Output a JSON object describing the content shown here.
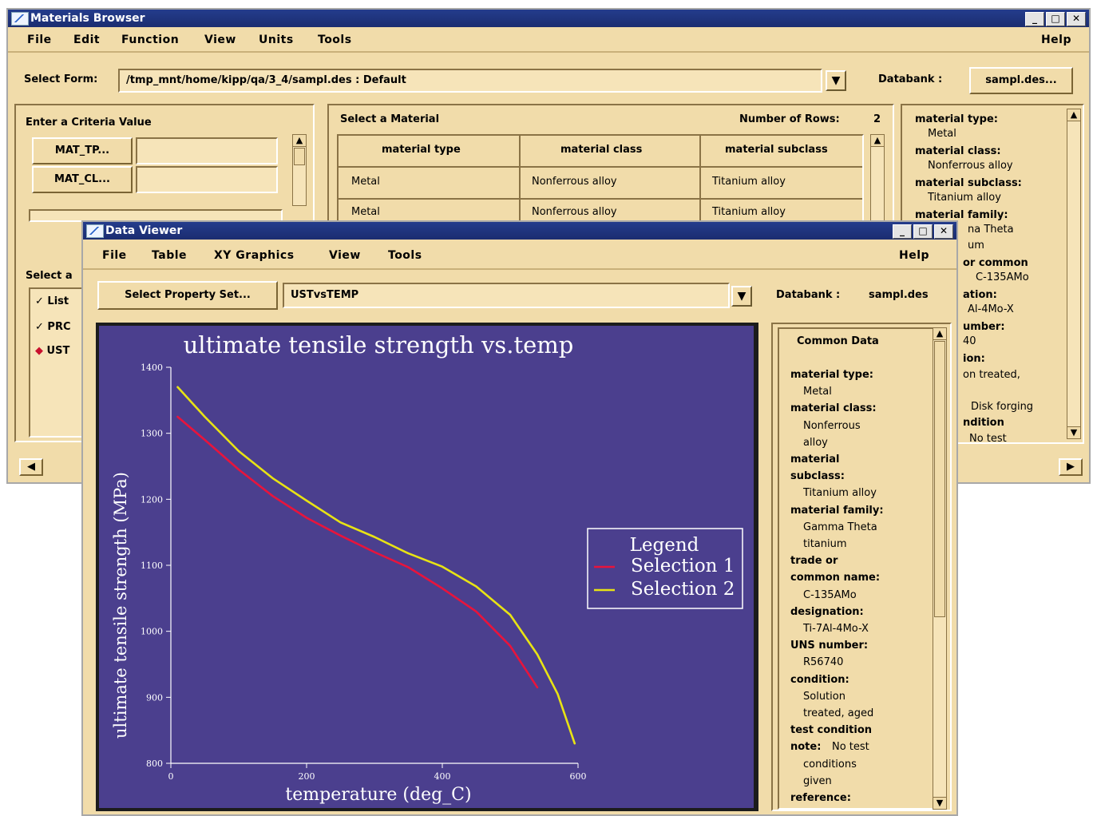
{
  "browser": {
    "title": "Materials Browser",
    "menus": [
      "File",
      "Edit",
      "Function",
      "View",
      "Units",
      "Tools"
    ],
    "help": "Help",
    "select_form_label": "Select Form:",
    "select_form_value": "/tmp_mnt/home/kipp/qa/3_4/sampl.des : Default",
    "databank_label": "Databank :",
    "databank_button": "sampl.des...",
    "criteria": {
      "title": "Enter a Criteria Value",
      "buttons": [
        "MAT_TP...",
        "MAT_CL..."
      ],
      "select_label": "Select a",
      "radio_items": [
        "List",
        "PRC",
        "UST"
      ]
    },
    "material_table": {
      "title": "Select a Material",
      "rows_label": "Number of Rows:",
      "rows_value": "2",
      "headers": [
        "material type",
        "material class",
        "material subclass"
      ],
      "rows": [
        [
          "Metal",
          "Nonferrous alloy",
          "Titanium alloy"
        ],
        [
          "Metal",
          "Nonferrous alloy",
          "Titanium alloy"
        ]
      ]
    },
    "side_panel": [
      {
        "k": "material type:",
        "v": "Metal"
      },
      {
        "k": "material class:",
        "v": "Nonferrous alloy"
      },
      {
        "k": "material subclass:",
        "v": "Titanium alloy"
      },
      {
        "k": "material family:",
        "v": "na Theta"
      },
      {
        "k": "",
        "v": "um"
      },
      {
        "k": "or common",
        "v": "C-135AMo"
      },
      {
        "k": "ation:",
        "v": "Al-4Mo-X"
      },
      {
        "k": "umber:",
        "v": "40"
      },
      {
        "k": "ion:",
        "v": "on treated,"
      },
      {
        "k": "",
        "v": "Disk forging"
      },
      {
        "k": "ndition",
        "v": "No test"
      }
    ]
  },
  "viewer": {
    "title": "Data Viewer",
    "menus": [
      "File",
      "Table",
      "XY Graphics",
      "View",
      "Tools"
    ],
    "help": "Help",
    "property_button": "Select Property Set...",
    "property_value": "USTvsTEMP",
    "databank_label": "Databank :",
    "databank_value": "sampl.des",
    "common_data": {
      "title": "Common Data",
      "lines": [
        {
          "t": "k",
          "s": "material type:"
        },
        {
          "t": "v",
          "s": "Metal"
        },
        {
          "t": "k",
          "s": "material class:"
        },
        {
          "t": "v",
          "s": "Nonferrous"
        },
        {
          "t": "v",
          "s": "alloy"
        },
        {
          "t": "k",
          "s": "material"
        },
        {
          "t": "k",
          "s": "subclass:"
        },
        {
          "t": "v",
          "s": "Titanium alloy"
        },
        {
          "t": "k",
          "s": "material family:"
        },
        {
          "t": "v",
          "s": "Gamma Theta"
        },
        {
          "t": "v",
          "s": "titanium"
        },
        {
          "t": "k",
          "s": "trade or"
        },
        {
          "t": "k",
          "s": "common name:"
        },
        {
          "t": "v",
          "s": "C-135AMo"
        },
        {
          "t": "k",
          "s": "designation:"
        },
        {
          "t": "v",
          "s": "Ti-7Al-4Mo-X"
        },
        {
          "t": "k",
          "s": "UNS number:"
        },
        {
          "t": "v",
          "s": "R56740"
        },
        {
          "t": "k",
          "s": "condition:"
        },
        {
          "t": "v",
          "s": "Solution"
        },
        {
          "t": "v",
          "s": "treated, aged"
        },
        {
          "t": "k",
          "s": "test condition"
        },
        {
          "t": "kv",
          "s": "note:",
          "v": "No test"
        },
        {
          "t": "v",
          "s": "conditions"
        },
        {
          "t": "v",
          "s": "given"
        },
        {
          "t": "k",
          "s": "reference:"
        }
      ]
    }
  },
  "chart_data": {
    "type": "line",
    "title": "ultimate tensile strength vs.temp",
    "xlabel": "temperature (deg_C)",
    "ylabel": "ultimate tensile strength (MPa)",
    "xlim": [
      0,
      600
    ],
    "ylim": [
      800,
      1400
    ],
    "xticks": [
      "0",
      "200",
      "400",
      "600"
    ],
    "yticks": [
      "800",
      "900",
      "1000",
      "1100",
      "1200",
      "1300",
      "1400"
    ],
    "legend_title": "Legend",
    "legend_position": "right",
    "background": "#4b3f8e",
    "series": [
      {
        "name": "Selection 1",
        "color": "#e8143c",
        "x": [
          10,
          50,
          100,
          150,
          200,
          250,
          300,
          350,
          400,
          450,
          500,
          540
        ],
        "y": [
          1325,
          1290,
          1245,
          1205,
          1172,
          1145,
          1120,
          1097,
          1065,
          1030,
          978,
          915
        ]
      },
      {
        "name": "Selection 2",
        "color": "#e8e314",
        "x": [
          10,
          50,
          100,
          150,
          200,
          250,
          300,
          350,
          400,
          450,
          500,
          540,
          570,
          595
        ],
        "y": [
          1370,
          1325,
          1273,
          1232,
          1198,
          1165,
          1143,
          1118,
          1098,
          1068,
          1025,
          965,
          905,
          830
        ]
      }
    ]
  }
}
